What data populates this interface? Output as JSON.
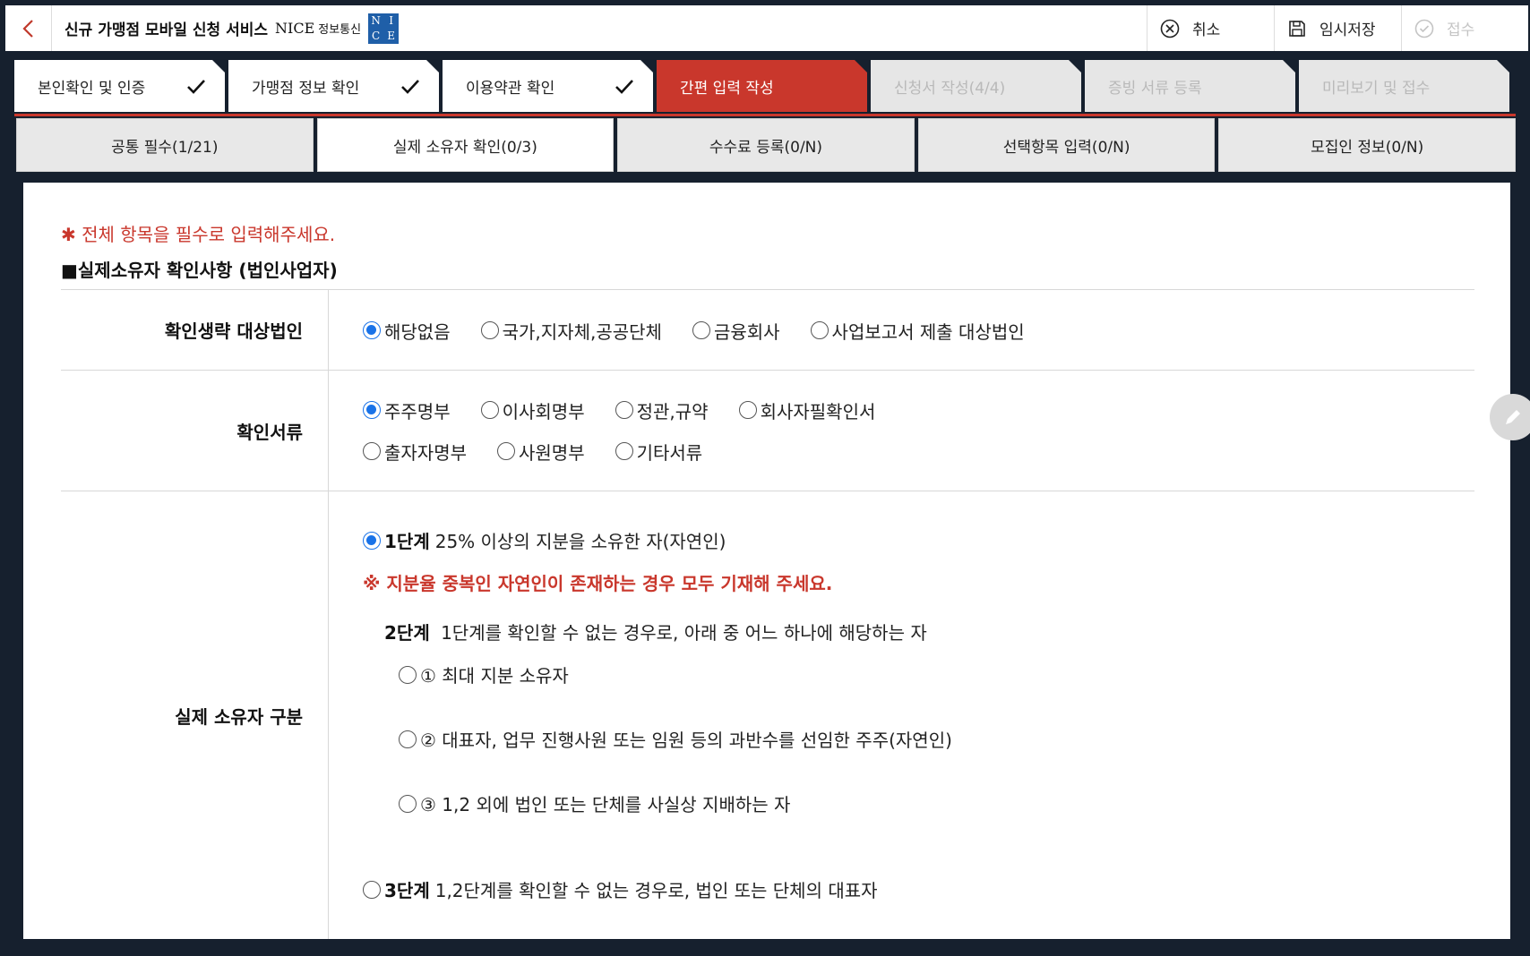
{
  "header": {
    "back_icon": "chevron-left-icon",
    "title": "신규 가맹점 모바일 신청 서비스",
    "brand": "NICE",
    "brand_sub": "정보통신",
    "logo_letters": [
      "N",
      "I",
      "C",
      "E"
    ],
    "actions": [
      {
        "icon": "cancel-circle-icon",
        "label": "취소",
        "enabled": true
      },
      {
        "icon": "save-icon",
        "label": "임시저장",
        "enabled": true
      },
      {
        "icon": "check-circle-icon",
        "label": "접수",
        "enabled": false
      }
    ]
  },
  "steps": [
    {
      "label": "본인확인 및 인증",
      "state": "done"
    },
    {
      "label": "가맹점 정보 확인",
      "state": "done"
    },
    {
      "label": "이용약관 확인",
      "state": "done"
    },
    {
      "label": "간편 입력 작성",
      "state": "active"
    },
    {
      "label": "신청서 작성(4/4)",
      "state": "inactive"
    },
    {
      "label": "증빙 서류 등록",
      "state": "inactive"
    },
    {
      "label": "미리보기 및 접수",
      "state": "inactive"
    }
  ],
  "subtabs": [
    {
      "label": "공통 필수(1/21)",
      "active": false
    },
    {
      "label": "실제 소유자 확인(0/3)",
      "active": true
    },
    {
      "label": "수수료 등록(0/N)",
      "active": false
    },
    {
      "label": "선택항목 입력(0/N)",
      "active": false
    },
    {
      "label": "모집인 정보(0/N)",
      "active": false
    }
  ],
  "form": {
    "required_note": "✱ 전체 항목을 필수로 입력해주세요.",
    "section_title": "■실제소유자 확인사항 (법인사업자)",
    "exempt": {
      "label": "확인생략 대상법인",
      "options": [
        "해당없음",
        "국가,지자체,공공단체",
        "금융회사",
        "사업보고서 제출 대상법인"
      ],
      "selected": 0
    },
    "documents": {
      "label": "확인서류",
      "options_row1": [
        "주주명부",
        "이사회명부",
        "정관,규약",
        "회사자필확인서"
      ],
      "options_row2": [
        "출자자명부",
        "사원명부",
        "기타서류"
      ],
      "selected": "주주명부"
    },
    "owner_type": {
      "label": "실제 소유자 구분",
      "stage1_title": "1단계",
      "stage1_desc": "25% 이상의 지분을 소유한 자(자연인)",
      "stage1_selected": true,
      "warning": "※ 지분율 중복인 자연인이 존재하는 경우 모두 기재해 주세요.",
      "stage2_title": "2단계",
      "stage2_desc": "1단계를 확인할 수 없는 경우로, 아래 중 어느 하나에 해당하는 자",
      "stage2_options": [
        "① 최대 지분 소유자",
        "② 대표자, 업무 진행사원 또는 임원 등의 과반수를 선임한 주주(자연인)",
        "③ 1,2 외에 법인 또는 단체를 사실상 지배하는 자"
      ],
      "stage3_title": "3단계",
      "stage3_desc": "1,2단계를 확인할 수 없는 경우로, 법인 또는 단체의 대표자"
    }
  },
  "fab_icon": "pencil-icon",
  "colors": {
    "accent": "#c9372c",
    "radio": "#1a73e8",
    "background": "#16202e"
  }
}
